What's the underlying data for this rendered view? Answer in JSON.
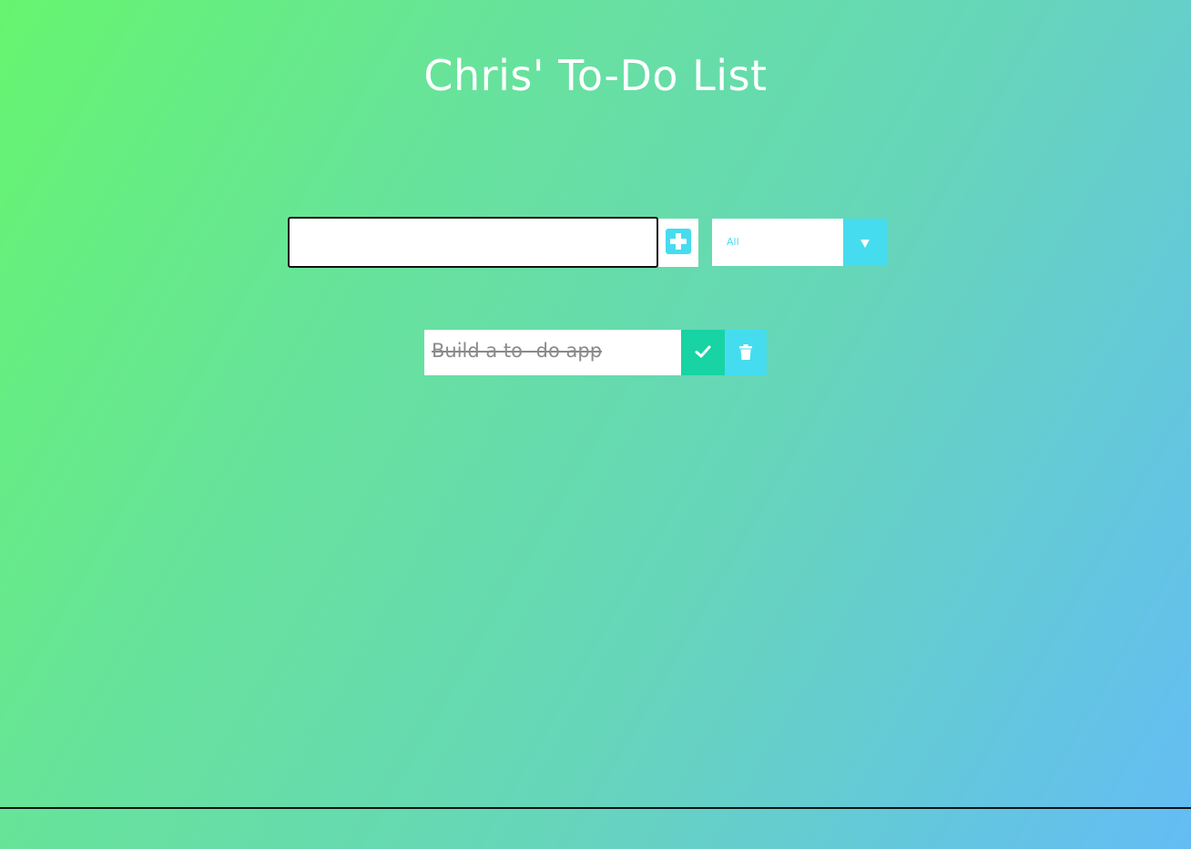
{
  "header": {
    "title": "Chris' To-Do List"
  },
  "form": {
    "input_value": "",
    "input_placeholder": "",
    "add_icon": "plus-square-icon",
    "filter": {
      "selected": "All",
      "arrow_icon": "caret-down-icon"
    }
  },
  "todos": [
    {
      "text": "Build a to- do app",
      "completed": true,
      "complete_icon": "check-icon",
      "delete_icon": "trash-icon"
    }
  ],
  "colors": {
    "accent": "#46dcef",
    "complete": "#18d3a4",
    "gradient_start": "#66f56f",
    "gradient_end": "#64bcf5"
  }
}
